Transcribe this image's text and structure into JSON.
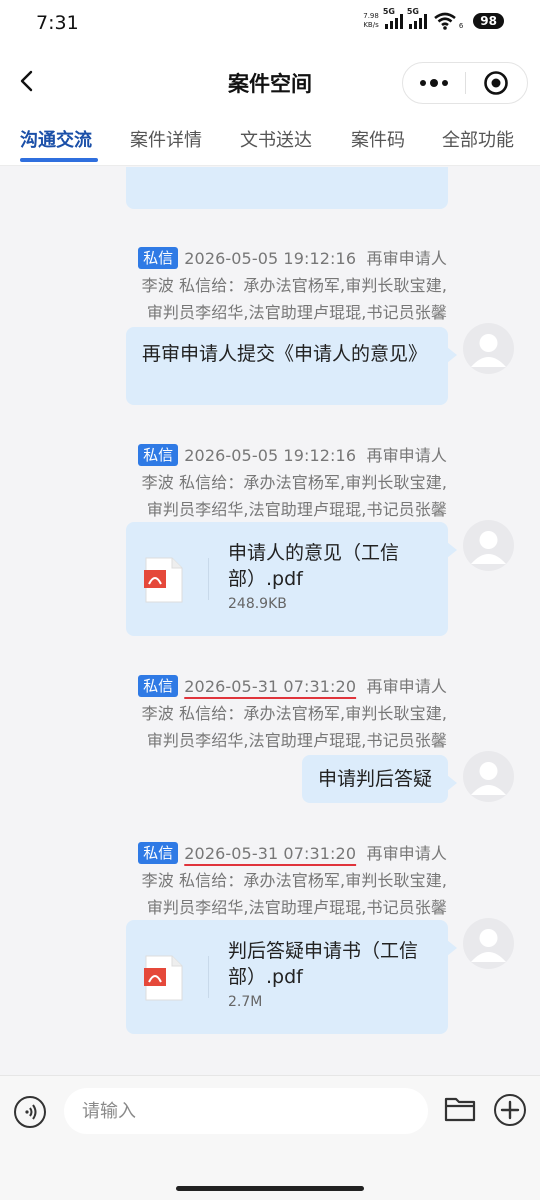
{
  "status_bar": {
    "time": "7:31",
    "net_speed_value": "7.98",
    "net_speed_unit": "KB/s",
    "signal1_label": "5G",
    "signal2_label": "5G",
    "wifi_sub": "6",
    "battery": "98"
  },
  "header": {
    "title": "案件空间"
  },
  "tabs": [
    {
      "label": "沟通交流",
      "active": true
    },
    {
      "label": "案件详情",
      "active": false
    },
    {
      "label": "文书送达",
      "active": false
    },
    {
      "label": "案件码",
      "active": false
    },
    {
      "label": "全部功能",
      "active": false
    }
  ],
  "messages": [
    {
      "badge": "私信",
      "time": "2026-05-05 19:12:16",
      "line1_rest": "再审申请人",
      "line2": "李波  私信给：承办法官杨军,审判长耿宝建,",
      "line3": "审判员李绍华,法官助理卢琨琨,书记员张馨",
      "text": "再审申请人提交《申请人的意见》"
    },
    {
      "badge": "私信",
      "time": "2026-05-05 19:12:16",
      "line1_rest": "再审申请人",
      "line2": "李波  私信给：承办法官杨军,审判长耿宝建,",
      "line3": "审判员李绍华,法官助理卢琨琨,书记员张馨",
      "file_name": "申请人的意见（工信部）.pdf",
      "file_size": "248.9KB"
    },
    {
      "badge": "私信",
      "time": "2026-05-31 07:31:20",
      "line1_rest": "再审申请人",
      "line2": "李波  私信给：承办法官杨军,审判长耿宝建,",
      "line3": "审判员李绍华,法官助理卢琨琨,书记员张馨",
      "text": "申请判后答疑"
    },
    {
      "badge": "私信",
      "time": "2026-05-31 07:31:20",
      "line1_rest": "再审申请人",
      "line2": "李波  私信给：承办法官杨军,审判长耿宝建,",
      "line3": "审判员李绍华,法官助理卢琨琨,书记员张馨",
      "file_name": "判后答疑申请书（工信部）.pdf",
      "file_size": "2.7M"
    }
  ],
  "input": {
    "placeholder": "请输入"
  },
  "colors": {
    "accent": "#2f6fde",
    "badge": "#2f7ae5",
    "bubble": "#dcecfb",
    "underline_mark": "#e0343b"
  }
}
